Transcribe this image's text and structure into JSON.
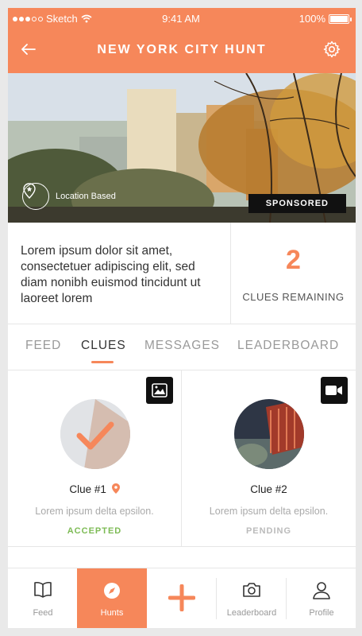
{
  "status_bar": {
    "carrier": "Sketch",
    "time": "9:41 AM",
    "battery": "100%"
  },
  "header": {
    "title": "NEW YORK CITY HUNT",
    "back_icon": "arrow-left-icon",
    "settings_icon": "gear-icon"
  },
  "hero": {
    "location_label": "Location Based",
    "sponsored_label": "SPONSORED"
  },
  "info": {
    "description": "Lorem ipsum dolor sit amet, consectetuer adipiscing elit, sed diam nonibh euismod tincidunt ut laoreet lorem",
    "clues_remaining_count": "2",
    "clues_remaining_label": "CLUES REMAINING"
  },
  "tabs": [
    {
      "label": "FEED",
      "active": false
    },
    {
      "label": "CLUES",
      "active": true
    },
    {
      "label": "MESSAGES",
      "active": false
    },
    {
      "label": "LEADERBOARD",
      "active": false
    }
  ],
  "clues": [
    {
      "name": "Clue #1",
      "text": "Lorem ipsum delta epsilon.",
      "status": "ACCEPTED",
      "status_color": "#7dbb55",
      "media": "image-icon"
    },
    {
      "name": "Clue #2",
      "text": "Lorem ipsum delta epsilon.",
      "status": "PENDING",
      "status_color": "#bbbbbb",
      "media": "video-icon"
    }
  ],
  "bottom_nav": [
    {
      "label": "Feed",
      "icon": "book-icon",
      "active": false
    },
    {
      "label": "Hunts",
      "icon": "compass-icon",
      "active": true
    },
    {
      "label": "",
      "icon": "plus-icon",
      "active": false
    },
    {
      "label": "Leaderboard",
      "icon": "camera-icon",
      "active": false
    },
    {
      "label": "Profile",
      "icon": "user-icon",
      "active": false
    }
  ],
  "colors": {
    "accent": "#f6875a",
    "accepted": "#7dbb55",
    "pending": "#bbbbbb"
  }
}
